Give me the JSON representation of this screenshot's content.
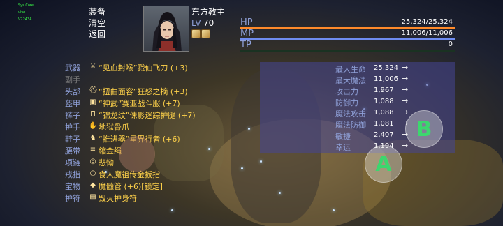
{
  "system_overlay": [
    "Sys Core:",
    "vivo",
    "V2243A"
  ],
  "menu": {
    "items": [
      {
        "label": "装备",
        "selected": true
      },
      {
        "label": "清空",
        "selected": false
      },
      {
        "label": "返回",
        "selected": false
      }
    ]
  },
  "hero": {
    "name": "东方教主",
    "level_label": "LV",
    "level_value": "70"
  },
  "stats": [
    {
      "label": "HP",
      "value": "25,324/25,324",
      "fill_fraction": 1.0,
      "color": "#ff8a2a"
    },
    {
      "label": "MP",
      "value": "11,006/11,006",
      "fill_fraction": 1.0,
      "color": "#6f8cf0"
    },
    {
      "label": "TP",
      "value": "0",
      "fill_fraction": 0.0,
      "color": "#4fd06a"
    }
  ],
  "equipment": [
    {
      "slot": "武器",
      "icon": "sword-icon",
      "name": "“见血封喉”戮仙飞刀 (+3)"
    },
    {
      "slot": "副手",
      "icon": "",
      "name": ""
    },
    {
      "slot": "头部",
      "icon": "helmet-icon",
      "name": "“扭曲面容”狂怒之摘 (+3)"
    },
    {
      "slot": "盔甲",
      "icon": "armor-icon",
      "name": "“神武”赛亚战斗服 (+7)"
    },
    {
      "slot": "裤子",
      "icon": "pants-icon",
      "name": "“锦龙纹”侏影迷踪护腿 (+7)"
    },
    {
      "slot": "护手",
      "icon": "gauntlet-icon",
      "name": "地狱骨爪"
    },
    {
      "slot": "鞋子",
      "icon": "boots-icon",
      "name": "“推进器”星界行者 (+6)"
    },
    {
      "slot": "腰带",
      "icon": "belt-icon",
      "name": "縮金绳"
    },
    {
      "slot": "项链",
      "icon": "necklace-icon",
      "name": "悲恸"
    },
    {
      "slot": "戒指",
      "icon": "ring-icon",
      "name": "食人魔祖传金扳指"
    },
    {
      "slot": "宝物",
      "icon": "treasure-icon",
      "name": "魔髓管 (+6)[锁定]"
    },
    {
      "slot": "护符",
      "icon": "amulet-icon",
      "name": "毁灭护身符"
    }
  ],
  "attributes": [
    {
      "label": "最大生命",
      "value": "25,324",
      "arrow": "→"
    },
    {
      "label": "最大魔法",
      "value": "11,006",
      "arrow": "→"
    },
    {
      "label": "攻击力",
      "value": "1,967",
      "arrow": "→"
    },
    {
      "label": "防御力",
      "value": "1,088",
      "arrow": "→"
    },
    {
      "label": "魔法攻击",
      "value": "1,088",
      "arrow": "→"
    },
    {
      "label": "魔法防御",
      "value": "1,081",
      "arrow": "→"
    },
    {
      "label": "敏捷",
      "value": "2,407",
      "arrow": "→"
    },
    {
      "label": "幸运",
      "value": "1,194",
      "arrow": "→"
    }
  ],
  "controls": {
    "button_a": "A",
    "button_b": "B"
  }
}
